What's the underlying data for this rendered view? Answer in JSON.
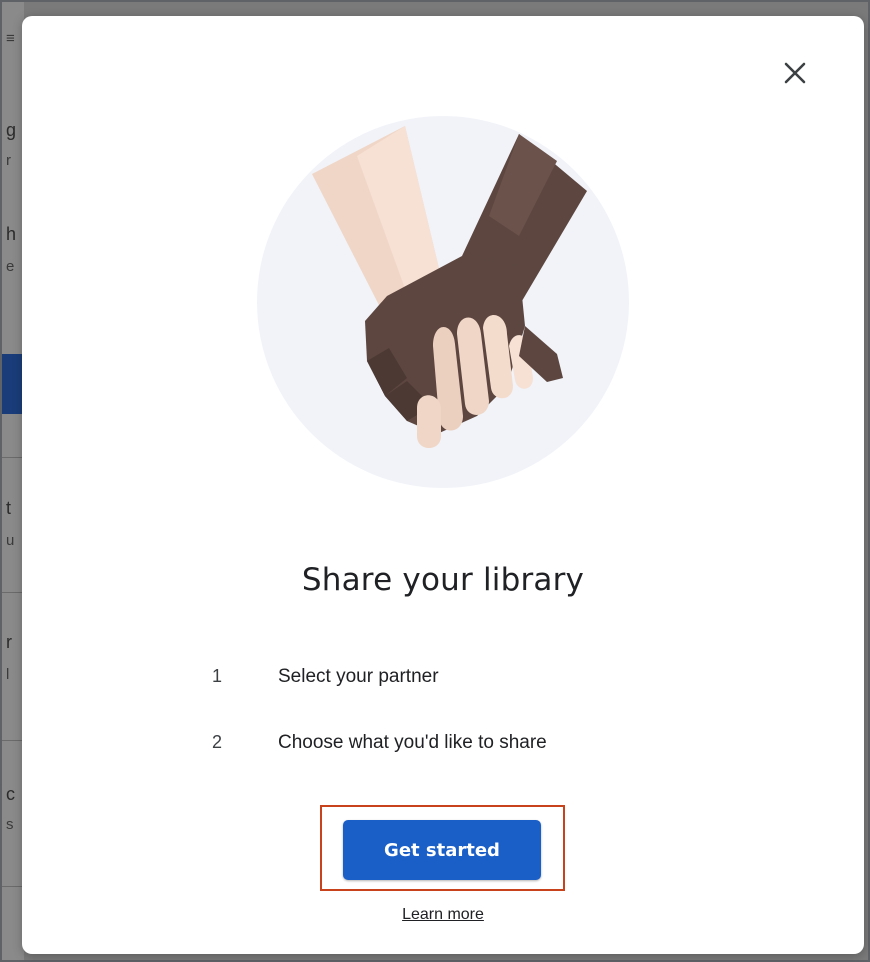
{
  "dialog": {
    "title": "Share your library",
    "steps": [
      {
        "number": "1",
        "label": "Select your partner"
      },
      {
        "number": "2",
        "label": "Choose what you'd like to share"
      }
    ],
    "primary_button": "Get started",
    "secondary_link": "Learn more",
    "close_icon": "close-icon",
    "illustration": "holding-hands-illustration",
    "colors": {
      "primary": "#1a5fc8",
      "highlight_border": "#c8431c",
      "illustration_bg": "#f1f3f8",
      "skin_light": "#f0d6c6",
      "skin_dark": "#5d4640"
    }
  }
}
